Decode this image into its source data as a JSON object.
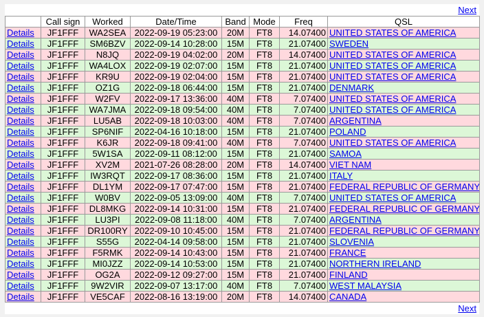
{
  "nav": {
    "next_top": "Next",
    "next_bottom": "Next"
  },
  "columns": [
    "",
    "Call sign",
    "Worked",
    "Date/Time",
    "Band",
    "Mode",
    "Freq",
    "QSL"
  ],
  "rows": [
    {
      "link": "Details",
      "call": "JF1FFF",
      "worked": "WA2SEA",
      "datetime": "2022-09-19 05:23:00",
      "band": "20M",
      "mode": "FT8",
      "freq": "14.07400",
      "qsl": "UNITED STATES OF AMERICA",
      "color": "pink"
    },
    {
      "link": "Details",
      "call": "JF1FFF",
      "worked": "SM6BZV",
      "datetime": "2022-09-14 10:28:00",
      "band": "15M",
      "mode": "FT8",
      "freq": "21.07400",
      "qsl": "SWEDEN",
      "color": "green"
    },
    {
      "link": "Details",
      "call": "JF1FFF",
      "worked": "N8JQ",
      "datetime": "2022-09-19 04:02:00",
      "band": "20M",
      "mode": "FT8",
      "freq": "14.07400",
      "qsl": "UNITED STATES OF AMERICA",
      "color": "pink"
    },
    {
      "link": "Details",
      "call": "JF1FFF",
      "worked": "WA4LOX",
      "datetime": "2022-09-19 02:07:00",
      "band": "15M",
      "mode": "FT8",
      "freq": "21.07400",
      "qsl": "UNITED STATES OF AMERICA",
      "color": "green"
    },
    {
      "link": "Details",
      "call": "JF1FFF",
      "worked": "KR9U",
      "datetime": "2022-09-19 02:04:00",
      "band": "15M",
      "mode": "FT8",
      "freq": "21.07400",
      "qsl": "UNITED STATES OF AMERICA",
      "color": "pink"
    },
    {
      "link": "Details",
      "call": "JF1FFF",
      "worked": "OZ1G",
      "datetime": "2022-09-18 06:44:00",
      "band": "15M",
      "mode": "FT8",
      "freq": "21.07400",
      "qsl": "DENMARK",
      "color": "green"
    },
    {
      "link": "Details",
      "call": "JF1FFF",
      "worked": "W2FV",
      "datetime": "2022-09-17 13:36:00",
      "band": "40M",
      "mode": "FT8",
      "freq": "7.07400",
      "qsl": "UNITED STATES OF AMERICA",
      "color": "pink"
    },
    {
      "link": "Details",
      "call": "JF1FFF",
      "worked": "WA7JMA",
      "datetime": "2022-09-18 09:54:00",
      "band": "40M",
      "mode": "FT8",
      "freq": "7.07400",
      "qsl": "UNITED STATES OF AMERICA",
      "color": "green"
    },
    {
      "link": "Details",
      "call": "JF1FFF",
      "worked": "LU5AB",
      "datetime": "2022-09-18 10:03:00",
      "band": "40M",
      "mode": "FT8",
      "freq": "7.07400",
      "qsl": "ARGENTINA",
      "color": "pink"
    },
    {
      "link": "Details",
      "call": "JF1FFF",
      "worked": "SP6NIF",
      "datetime": "2022-04-16 10:18:00",
      "band": "15M",
      "mode": "FT8",
      "freq": "21.07400",
      "qsl": "POLAND",
      "color": "green"
    },
    {
      "link": "Details",
      "call": "JF1FFF",
      "worked": "K6JR",
      "datetime": "2022-09-18 09:41:00",
      "band": "40M",
      "mode": "FT8",
      "freq": "7.07400",
      "qsl": "UNITED STATES OF AMERICA",
      "color": "pink"
    },
    {
      "link": "Details",
      "call": "JF1FFF",
      "worked": "5W1SA",
      "datetime": "2022-09-11 08:12:00",
      "band": "15M",
      "mode": "FT8",
      "freq": "21.07400",
      "qsl": "SAMOA",
      "color": "green"
    },
    {
      "link": "Details",
      "call": "JF1FFF",
      "worked": "XV2M",
      "datetime": "2021-07-26 08:28:00",
      "band": "20M",
      "mode": "FT8",
      "freq": "14.07400",
      "qsl": "VIET NAM",
      "color": "pink"
    },
    {
      "link": "Details",
      "call": "JF1FFF",
      "worked": "IW3RQT",
      "datetime": "2022-09-17 08:36:00",
      "band": "15M",
      "mode": "FT8",
      "freq": "21.07400",
      "qsl": "ITALY",
      "color": "green"
    },
    {
      "link": "Details",
      "call": "JF1FFF",
      "worked": "DL1YM",
      "datetime": "2022-09-17 07:47:00",
      "band": "15M",
      "mode": "FT8",
      "freq": "21.07400",
      "qsl": "FEDERAL REPUBLIC OF GERMANY",
      "color": "pink"
    },
    {
      "link": "Details",
      "call": "JF1FFF",
      "worked": "W0BV",
      "datetime": "2022-09-05 13:09:00",
      "band": "40M",
      "mode": "FT8",
      "freq": "7.07400",
      "qsl": "UNITED STATES OF AMERICA",
      "color": "green"
    },
    {
      "link": "Details",
      "call": "JF1FFF",
      "worked": "DL8MKG",
      "datetime": "2022-09-14 10:31:00",
      "band": "15M",
      "mode": "FT8",
      "freq": "21.07400",
      "qsl": "FEDERAL REPUBLIC OF GERMANY",
      "color": "pink"
    },
    {
      "link": "Details",
      "call": "JF1FFF",
      "worked": "LU3PI",
      "datetime": "2022-09-08 11:18:00",
      "band": "40M",
      "mode": "FT8",
      "freq": "7.07400",
      "qsl": "ARGENTINA",
      "color": "green"
    },
    {
      "link": "Details",
      "call": "JF1FFF",
      "worked": "DR100RY",
      "datetime": "2022-09-10 10:45:00",
      "band": "15M",
      "mode": "FT8",
      "freq": "21.07400",
      "qsl": "FEDERAL REPUBLIC OF GERMANY",
      "color": "pink"
    },
    {
      "link": "Details",
      "call": "JF1FFF",
      "worked": "S55G",
      "datetime": "2022-04-14 09:58:00",
      "band": "15M",
      "mode": "FT8",
      "freq": "21.07400",
      "qsl": "SLOVENIA",
      "color": "green"
    },
    {
      "link": "Details",
      "call": "JF1FFF",
      "worked": "F5RMK",
      "datetime": "2022-09-14 10:43:00",
      "band": "15M",
      "mode": "FT8",
      "freq": "21.07400",
      "qsl": "FRANCE",
      "color": "pink"
    },
    {
      "link": "Details",
      "call": "JF1FFF",
      "worked": "MI0JZZ",
      "datetime": "2022-09-14 10:53:00",
      "band": "15M",
      "mode": "FT8",
      "freq": "21.07400",
      "qsl": "NORTHERN IRELAND",
      "color": "green"
    },
    {
      "link": "Details",
      "call": "JF1FFF",
      "worked": "OG2A",
      "datetime": "2022-09-12 09:27:00",
      "band": "15M",
      "mode": "FT8",
      "freq": "21.07400",
      "qsl": "FINLAND",
      "color": "pink"
    },
    {
      "link": "Details",
      "call": "JF1FFF",
      "worked": "9W2VIR",
      "datetime": "2022-09-07 13:17:00",
      "band": "40M",
      "mode": "FT8",
      "freq": "7.07400",
      "qsl": "WEST MALAYSIA",
      "color": "green"
    },
    {
      "link": "Details",
      "call": "JF1FFF",
      "worked": "VE5CAF",
      "datetime": "2022-08-16 13:19:00",
      "band": "20M",
      "mode": "FT8",
      "freq": "14.07400",
      "qsl": "CANADA",
      "color": "pink"
    }
  ],
  "colors": {
    "pink_row": "#ffd9de",
    "green_row": "#dcf7d7",
    "link": "#0000ee",
    "border": "#9a9a9a"
  }
}
